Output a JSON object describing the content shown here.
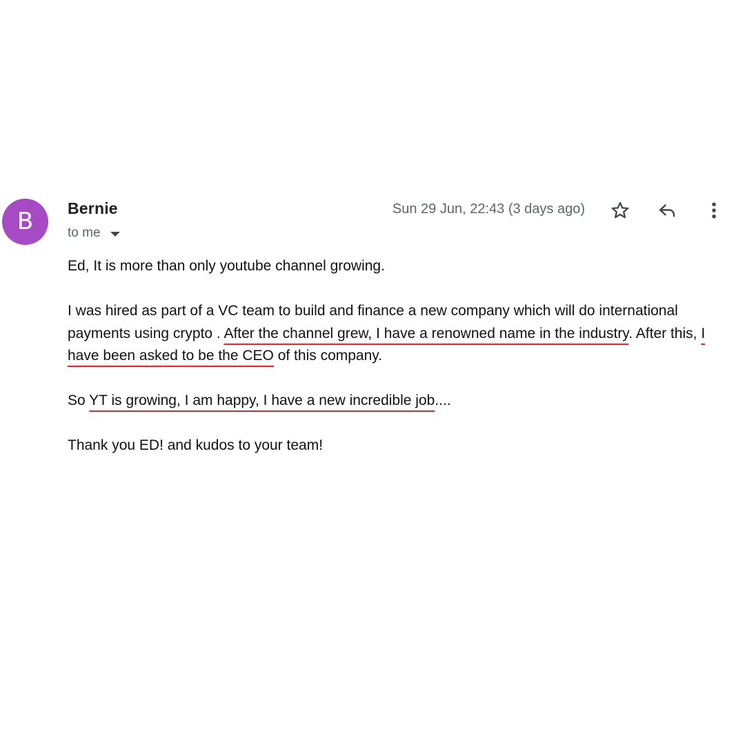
{
  "sender": {
    "avatar_letter": "B",
    "avatar_color": "#a64bc4",
    "name": "Bernie",
    "recipient_label": "to me"
  },
  "header": {
    "timestamp": "Sun 29 Jun, 22:43 (3 days ago)",
    "icons": [
      "star-icon",
      "reply-icon",
      "more-vert-icon"
    ]
  },
  "body": {
    "p1": "Ed, It is more than only youtube channel growing.",
    "p2": {
      "a": "I was hired as part of a VC team to build and finance a new company which will do international payments using crypto . ",
      "b_underlined": "After the channel grew, I have a renowned name in the industry",
      "c": ". After this, ",
      "d_underlined": "I have been asked to be the CEO",
      "e": " of this company."
    },
    "p3": {
      "a": "So ",
      "b_underlined": "YT is growing, I am happy, I have a new incredible job",
      "c": "...."
    },
    "p4": "Thank you ED! and kudos to your team!",
    "underline_color": "#e3242b"
  }
}
